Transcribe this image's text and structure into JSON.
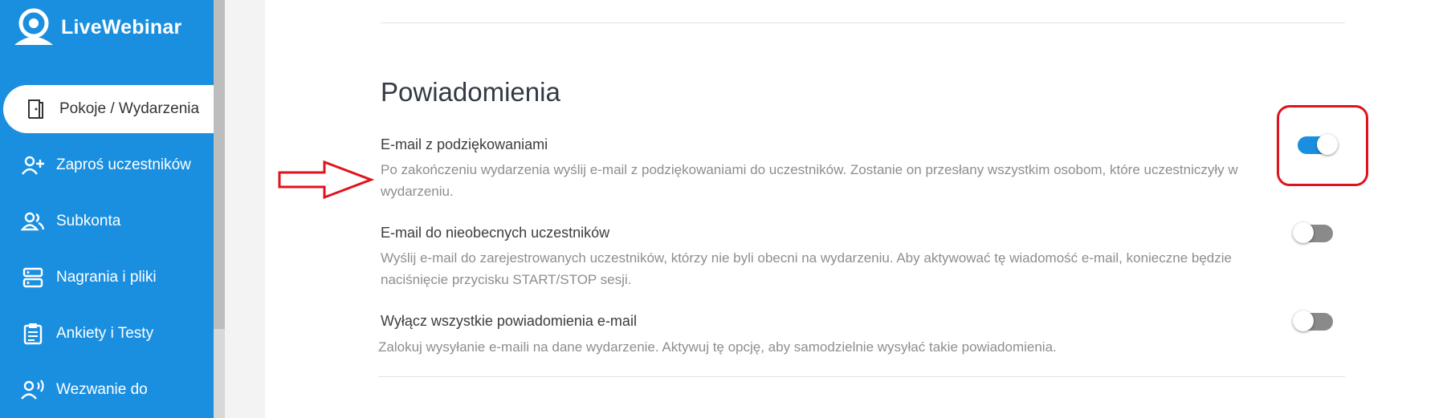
{
  "brand": {
    "name": "LiveWebinar",
    "color": "#1a8fe0"
  },
  "sidebar": {
    "items": [
      {
        "label": "Pokoje / Wydarzenia",
        "icon": "door-icon",
        "active": true
      },
      {
        "label": "Zaproś uczestników",
        "icon": "add-user-icon",
        "active": false
      },
      {
        "label": "Subkonta",
        "icon": "users-icon",
        "active": false
      },
      {
        "label": "Nagrania i pliki",
        "icon": "storage-icon",
        "active": false
      },
      {
        "label": "Ankiety i Testy",
        "icon": "clipboard-icon",
        "active": false
      },
      {
        "label": "Wezwanie do",
        "icon": "speaking-user-icon",
        "active": false
      }
    ]
  },
  "notifications": {
    "title": "Powiadomienia",
    "options": [
      {
        "title": "E-mail z podziękowaniami",
        "description": "Po zakończeniu wydarzenia wyślij e-mail z podziękowaniami do uczestników. Zostanie on przesłany wszystkim osobom, które uczestniczyły w wydarzeniu.",
        "enabled": true
      },
      {
        "title": "E-mail do nieobecnych uczestników",
        "description": "Wyślij e-mail do zarejestrowanych uczestników, którzy nie byli obecni na wydarzeniu. Aby aktywować tę wiadomość e-mail, konieczne będzie naciśnięcie przycisku START/STOP sesji.",
        "enabled": false
      },
      {
        "title": "Wyłącz wszystkie powiadomienia e-mail",
        "description": "Zalokuj wysyłanie e-maili na dane wydarzenie. Aktywuj tę opcję, aby samodzielnie wysyłać takie powiadomienia.",
        "enabled": false
      }
    ]
  },
  "annotation": {
    "color": "#e0131c"
  }
}
